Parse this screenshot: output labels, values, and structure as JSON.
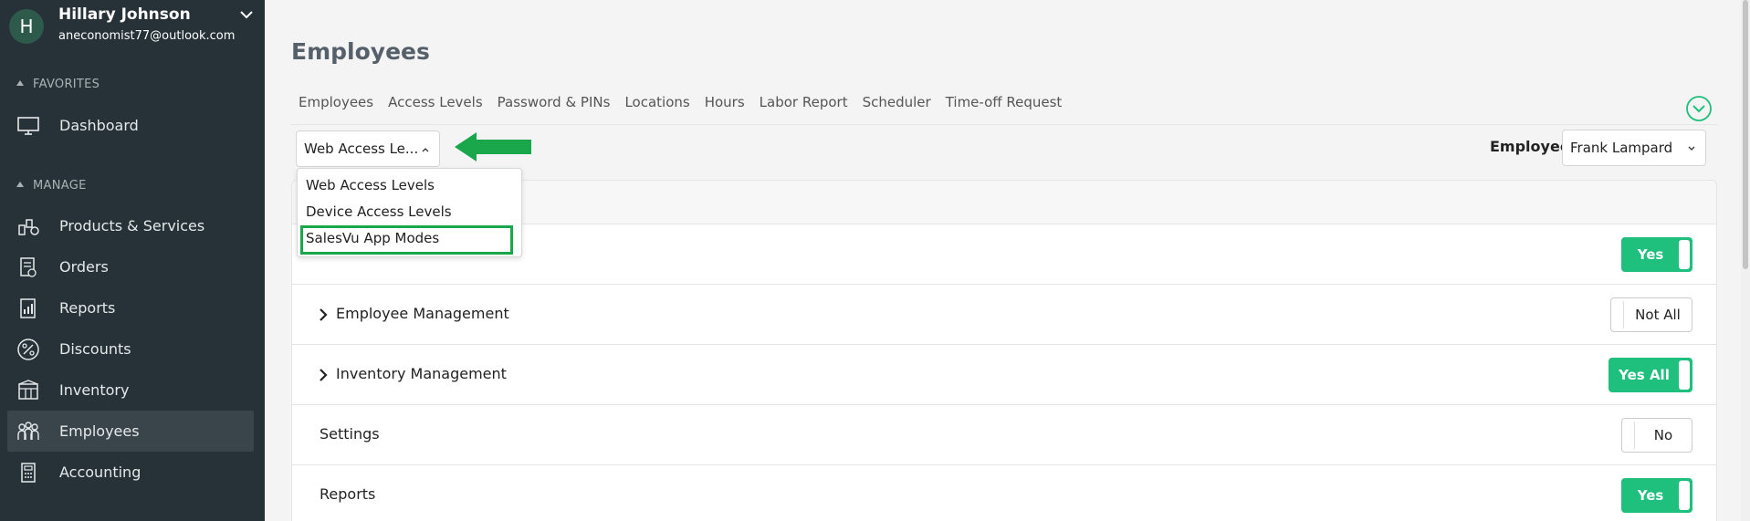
{
  "user": {
    "initial": "H",
    "name": "Hillary Johnson",
    "email": "aneconomist77@outlook.com"
  },
  "sidebar": {
    "favorites_label": "FAVORITES",
    "manage_label": "MANAGE",
    "favorites": [
      {
        "label": "Dashboard",
        "icon": "monitor-icon"
      }
    ],
    "items": [
      {
        "label": "Products & Services",
        "icon": "products-icon"
      },
      {
        "label": "Orders",
        "icon": "orders-icon"
      },
      {
        "label": "Reports",
        "icon": "reports-icon"
      },
      {
        "label": "Discounts",
        "icon": "percent-icon"
      },
      {
        "label": "Inventory",
        "icon": "inventory-icon"
      },
      {
        "label": "Employees",
        "icon": "employees-icon",
        "active": true
      },
      {
        "label": "Accounting",
        "icon": "calculator-icon"
      }
    ]
  },
  "page": {
    "title": "Employees",
    "tabs": [
      "Employees",
      "Access Levels",
      "Password & PINs",
      "Locations",
      "Hours",
      "Labor Report",
      "Scheduler",
      "Time-off Request"
    ]
  },
  "access_select": {
    "value": "Web Access Le...",
    "options": [
      "Web Access Levels",
      "Device Access Levels",
      "SalesVu App Modes"
    ],
    "highlighted_option": "SalesVu App Modes"
  },
  "employee_select": {
    "label": "Employee",
    "value": "Frank Lampard"
  },
  "permissions": [
    {
      "label": "",
      "toggle": "Yes",
      "state": "on",
      "expandable": false
    },
    {
      "label": "Employee Management",
      "toggle": "Not All",
      "state": "off",
      "expandable": true
    },
    {
      "label": "Inventory Management",
      "toggle": "Yes All",
      "state": "on",
      "expandable": true
    },
    {
      "label": "Settings",
      "toggle": "No",
      "state": "off",
      "expandable": false
    },
    {
      "label": "Reports",
      "toggle": "Yes",
      "state": "on",
      "expandable": false
    }
  ],
  "colors": {
    "sidebar_bg": "#263238",
    "accent_green": "#1fbf7d",
    "arrow_green": "#1aa64a"
  }
}
